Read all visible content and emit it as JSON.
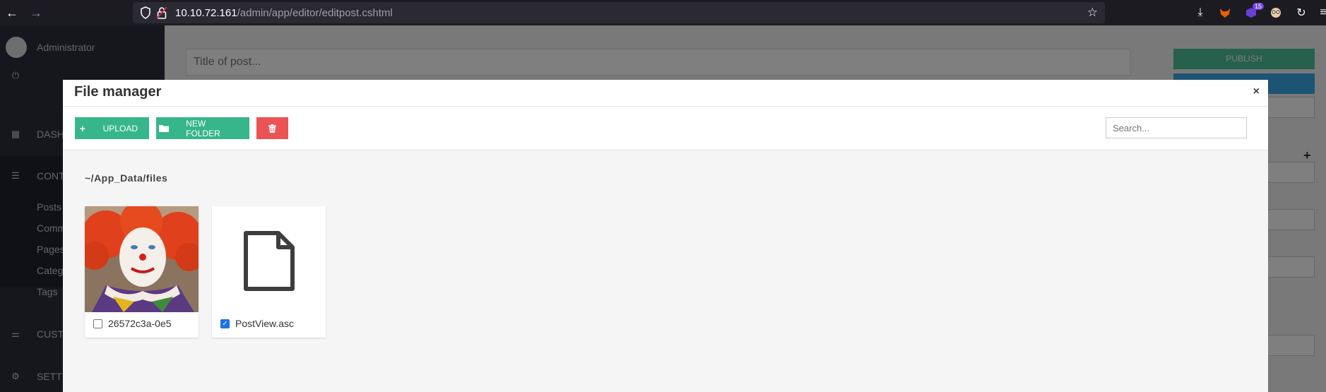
{
  "browser": {
    "url_host": "10.10.72.161",
    "url_path": "/admin/app/editor/editpost.cshtml",
    "extension_badge": "15"
  },
  "sidebar": {
    "user": "Administrator",
    "items": [
      {
        "label": "DASH",
        "icon": "dashboard-icon"
      },
      {
        "label": "CONT",
        "icon": "list-icon"
      },
      {
        "label": "CUST",
        "icon": "sliders-icon"
      },
      {
        "label": "SETT",
        "icon": "gear-icon"
      }
    ],
    "sub_items": [
      "Posts",
      "Comm",
      "Pages",
      "Categ",
      "Tags"
    ]
  },
  "editor": {
    "title_placeholder": "Title of post...",
    "publish_label": "PUBLISH"
  },
  "file_manager": {
    "title": "File manager",
    "close": "×",
    "upload_label": "UPLOAD",
    "new_folder_label": "NEW FOLDER",
    "search_placeholder": "Search...",
    "path": "~/App_Data/files",
    "files": [
      {
        "name": "26572c3a-0e5",
        "checked": false,
        "kind": "image"
      },
      {
        "name": "PostView.asc",
        "checked": true,
        "kind": "document"
      }
    ]
  }
}
